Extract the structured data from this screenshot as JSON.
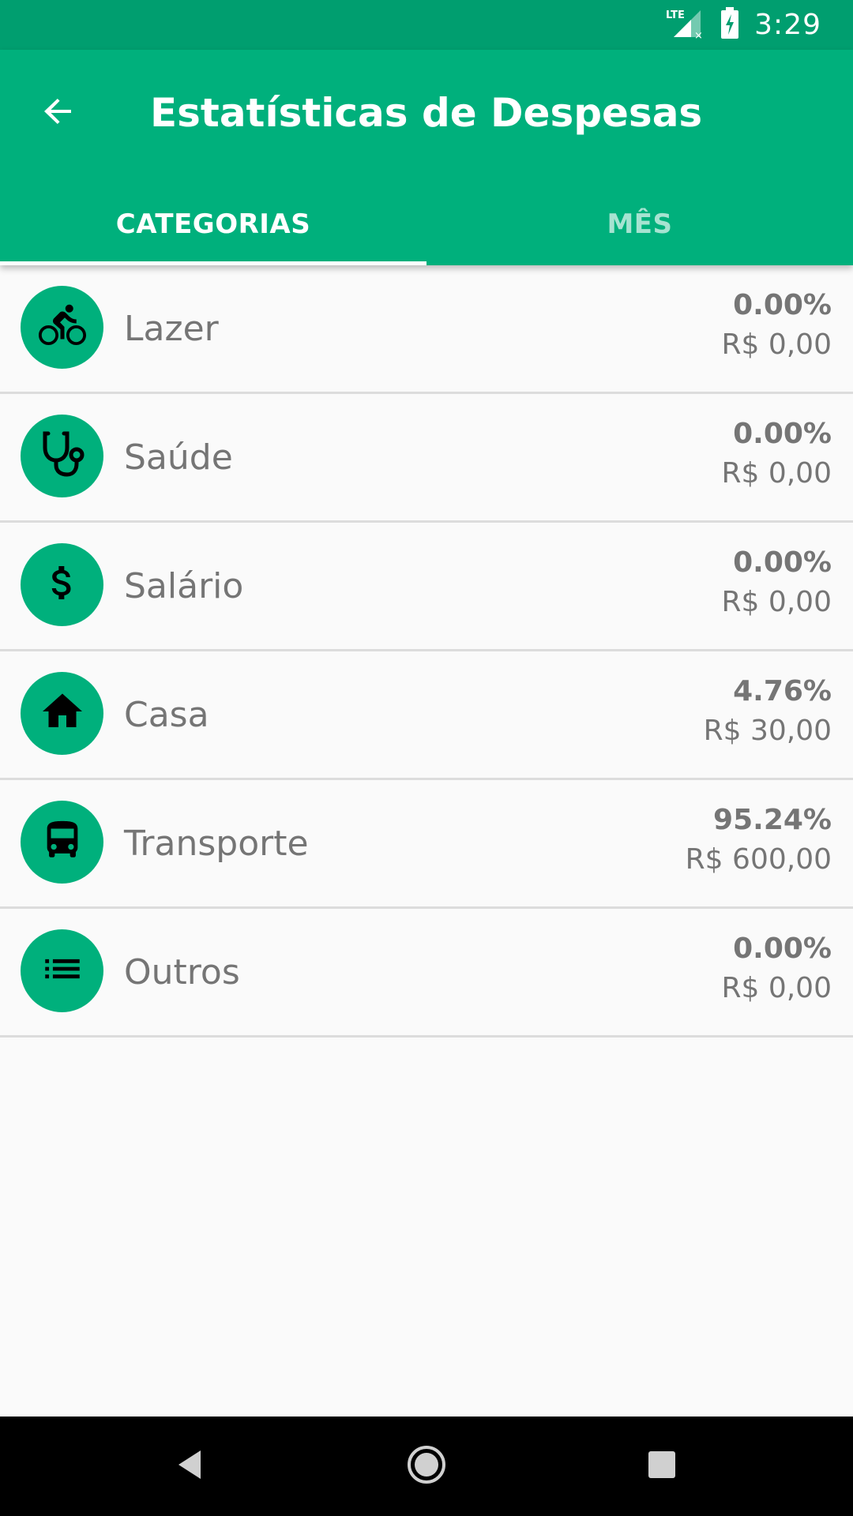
{
  "status_bar": {
    "network": "LTE",
    "time": "3:29"
  },
  "header": {
    "title": "Estatísticas de Despesas",
    "back_icon": "arrow-back-icon"
  },
  "tabs": [
    {
      "label": "CATEGORIAS",
      "selected": true
    },
    {
      "label": "MÊS",
      "selected": false
    }
  ],
  "categories": [
    {
      "label": "Lazer",
      "percent": "0.00%",
      "amount": "R$ 0,00",
      "icon": "bike-icon"
    },
    {
      "label": "Saúde",
      "percent": "0.00%",
      "amount": "R$ 0,00",
      "icon": "stethoscope-icon"
    },
    {
      "label": "Salário",
      "percent": "0.00%",
      "amount": "R$ 0,00",
      "icon": "dollar-icon"
    },
    {
      "label": "Casa",
      "percent": "4.76%",
      "amount": "R$ 30,00",
      "icon": "home-icon"
    },
    {
      "label": "Transporte",
      "percent": "95.24%",
      "amount": "R$ 600,00",
      "icon": "bus-icon"
    },
    {
      "label": "Outros",
      "percent": "0.00%",
      "amount": "R$ 0,00",
      "icon": "list-icon"
    }
  ],
  "colors": {
    "primary": "#00b07c",
    "primary_dark": "#009e6f",
    "text_secondary": "#757575"
  }
}
